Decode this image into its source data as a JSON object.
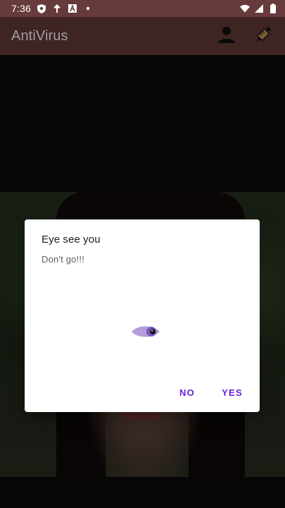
{
  "status_bar": {
    "time": "7:36",
    "left_icons": [
      "shield-icon",
      "location-icon",
      "a-box-icon",
      "dot-icon"
    ],
    "right_icons": [
      "wifi-icon",
      "signal-icon",
      "battery-icon"
    ]
  },
  "app_bar": {
    "title": "AntiVirus",
    "actions": [
      "person-icon",
      "syringe-icon"
    ]
  },
  "dialog": {
    "title": "Eye see you",
    "message": "Don't go!!!",
    "icon": "eye-icon",
    "buttons": {
      "no": "NO",
      "yes": "YES"
    }
  },
  "colors": {
    "app_bar": "#673a3b",
    "dialog_button": "#6a1fd8",
    "eye": "#b39ddb"
  }
}
